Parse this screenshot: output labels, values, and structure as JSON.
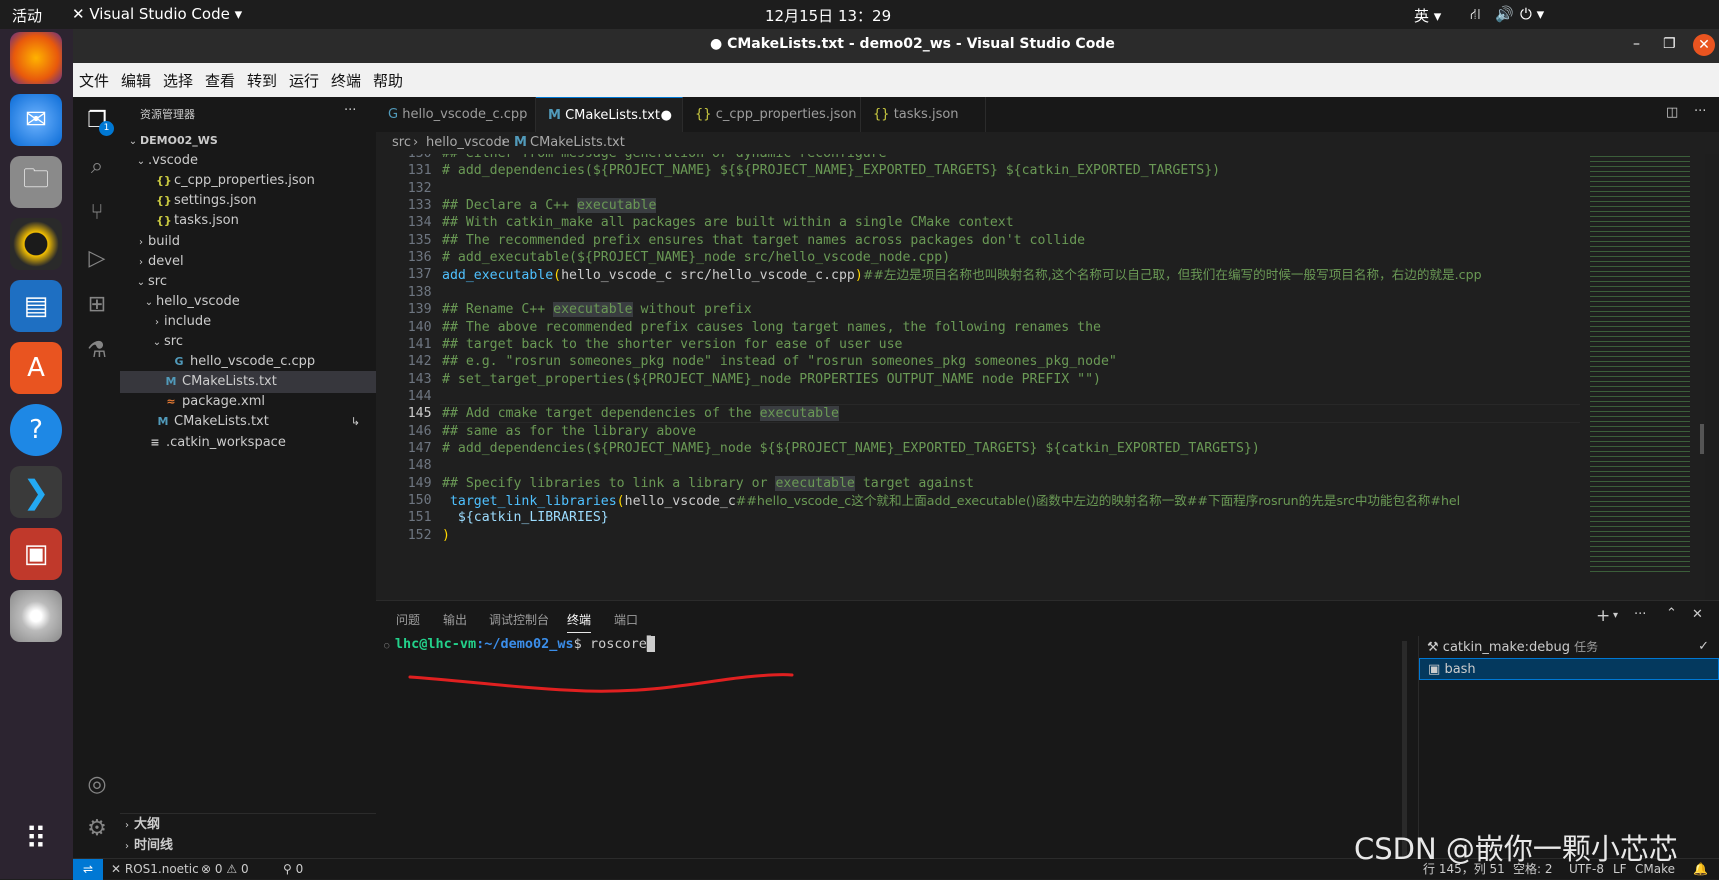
{
  "topbar": {
    "activities": "活动",
    "app_name": "Visual Studio Code",
    "clock": "12月15日 13：29",
    "input_method": "英"
  },
  "window": {
    "title": "● CMakeLists.txt - demo02_ws - Visual Studio Code"
  },
  "menu": [
    "文件",
    "编辑",
    "选择",
    "查看",
    "转到",
    "运行",
    "终端",
    "帮助"
  ],
  "activity_badge": "1",
  "sidebar": {
    "title": "资源管理器",
    "more": "···",
    "items": [
      {
        "label": "DEMO02_WS",
        "chev": "⌄",
        "icon": "",
        "bold": true
      },
      {
        "label": ".vscode",
        "chev": "⌄",
        "icon": ""
      },
      {
        "label": "c_cpp_properties.json",
        "chev": "",
        "icon": "{}"
      },
      {
        "label": "settings.json",
        "chev": "",
        "icon": "{}"
      },
      {
        "label": "tasks.json",
        "chev": "",
        "icon": "{}"
      },
      {
        "label": "build",
        "chev": "›",
        "icon": ""
      },
      {
        "label": "devel",
        "chev": "›",
        "icon": ""
      },
      {
        "label": "src",
        "chev": "⌄",
        "icon": ""
      },
      {
        "label": "hello_vscode",
        "chev": "⌄",
        "icon": ""
      },
      {
        "label": "include",
        "chev": "›",
        "icon": ""
      },
      {
        "label": "src",
        "chev": "⌄",
        "icon": ""
      },
      {
        "label": "hello_vscode_c.cpp",
        "chev": "",
        "icon": "G"
      },
      {
        "label": "CMakeLists.txt",
        "chev": "",
        "icon": "M"
      },
      {
        "label": "package.xml",
        "chev": "",
        "icon": "≈"
      },
      {
        "label": "CMakeLists.txt",
        "chev": "",
        "icon": "M"
      },
      {
        "label": ".catkin_workspace",
        "chev": "",
        "icon": "≡"
      }
    ],
    "outline": "大纲",
    "timeline": "时间线"
  },
  "tabs": [
    "hello_vscode_c.cpp",
    "CMakeLists.txt",
    "c_cpp_properties.json",
    "tasks.json"
  ],
  "tab_icons": [
    "G",
    "M",
    "{}",
    "{}"
  ],
  "breadcrumb": [
    "src",
    "hello_vscode",
    "CMakeLists.txt"
  ],
  "editor": {
    "lines": [
      {
        "n": "130",
        "t": "## either from message generation or dynamic reconfigure"
      },
      {
        "n": "131",
        "t": "# add_dependencies(${PROJECT_NAME} ${${PROJECT_NAME}_EXPORTED_TARGETS} ${catkin_EXPORTED_TARGETS})"
      },
      {
        "n": "132",
        "t": ""
      },
      {
        "n": "133",
        "t": "## Declare a C++ ",
        "h": "executable",
        "r": ""
      },
      {
        "n": "134",
        "t": "## With catkin_make all packages are built within a single CMake context"
      },
      {
        "n": "135",
        "t": "## The recommended prefix ensures that target names across packages don't collide"
      },
      {
        "n": "136",
        "t": "# add_executable(${PROJECT_NAME}_node src/hello_vscode_node.cpp)"
      },
      {
        "n": "137",
        "t": "",
        "special": "exec"
      },
      {
        "n": "138",
        "t": ""
      },
      {
        "n": "139",
        "t": "## Rename C++ ",
        "h": "executable",
        "r": " without prefix"
      },
      {
        "n": "140",
        "t": "## The above recommended prefix causes long target names, the following renames the"
      },
      {
        "n": "141",
        "t": "## target back to the shorter version for ease of user use"
      },
      {
        "n": "142",
        "t": "## e.g. \"rosrun someones_pkg node\" instead of \"rosrun someones_pkg someones_pkg_node\""
      },
      {
        "n": "143",
        "t": "# set_target_properties(${PROJECT_NAME}_node PROPERTIES OUTPUT_NAME node PREFIX \"\")"
      },
      {
        "n": "144",
        "t": ""
      },
      {
        "n": "145",
        "t": "## Add cmake target dependencies of the ",
        "h": "executable",
        "r": ""
      },
      {
        "n": "146",
        "t": "## same as for the library above"
      },
      {
        "n": "147",
        "t": "# add_dependencies(${PROJECT_NAME}_node ${${PROJECT_NAME}_EXPORTED_TARGETS} ${catkin_EXPORTED_TARGETS})"
      },
      {
        "n": "148",
        "t": ""
      },
      {
        "n": "149",
        "t": "## Specify libraries to link a library or ",
        "h": "executable",
        "r": " target against"
      },
      {
        "n": "150",
        "t": "",
        "special": "link"
      },
      {
        "n": "151",
        "t": "",
        "special": "libs"
      },
      {
        "n": "152",
        "t": "",
        "special": "close"
      }
    ],
    "exec_fn": "add_executable",
    "exec_args": "hello_vscode_c src/hello_vscode_c.cpp",
    "exec_comment": "##左边是项目名称也叫映射名称,这个名称可以自己取，但我们在编写的时候一般写项目名称，右边的就是.cpp",
    "link_fn": "target_link_libraries",
    "link_arg": "hello_vscode_c",
    "link_comment": "##hello_vscode_c这个就和上面add_executable()函数中左边的映射名称一致##下面程序rosrun的先是src中功能包名称#hel",
    "libs": "${catkin_LIBRARIES}"
  },
  "panel": {
    "tabs": [
      "问题",
      "输出",
      "调试控制台",
      "终端",
      "端口"
    ],
    "prompt_user": "lhc@lhc-vm",
    "prompt_path": ":~/demo02_ws",
    "prompt_end": "$ ",
    "command": "roscore",
    "terminals": [
      {
        "label": "catkin_make:debug",
        "tag": "任务"
      },
      {
        "label": "bash",
        "tag": ""
      }
    ]
  },
  "status": {
    "remote": "ROS1.noetic",
    "errors": "0",
    "warnings": "0",
    "ports": "0",
    "position": "行 145，列 51",
    "spaces": "空格: 2",
    "encoding": "UTF-8",
    "eol": "LF",
    "lang": "CMake"
  },
  "watermark": "CSDN @嵌你一颗小芯芯"
}
